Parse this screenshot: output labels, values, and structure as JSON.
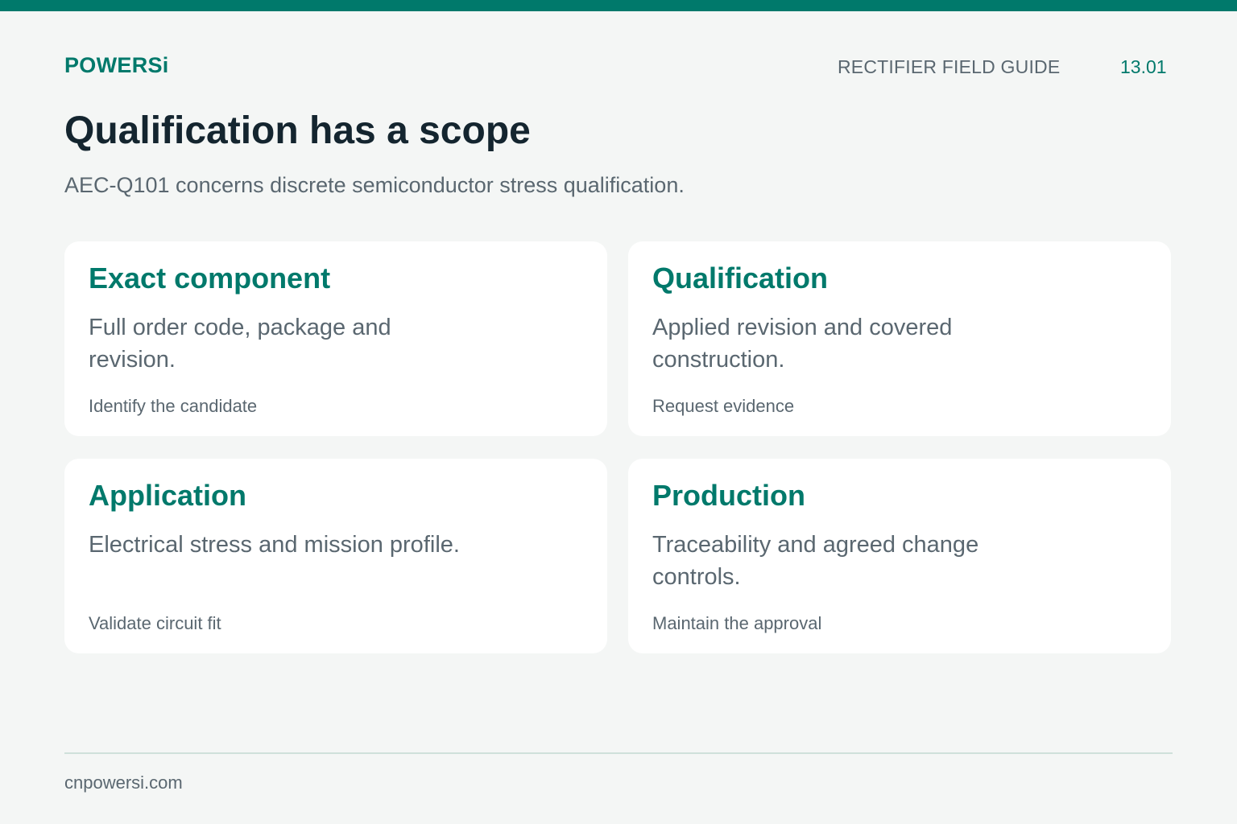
{
  "header": {
    "brand": "POWERSi",
    "guide_name": "RECTIFIER FIELD GUIDE",
    "page_number": "13.01"
  },
  "main": {
    "title": "Qualification has a scope",
    "subtitle": "AEC-Q101 concerns discrete semiconductor stress qualification."
  },
  "cards": [
    {
      "title": "Exact component",
      "body": "Full order code, package and revision.",
      "action": "Identify the candidate"
    },
    {
      "title": "Qualification",
      "body": "Applied revision and covered construction.",
      "action": "Request evidence"
    },
    {
      "title": "Application",
      "body": "Electrical stress and mission profile.",
      "action": "Validate circuit fit"
    },
    {
      "title": "Production",
      "body": "Traceability and agreed change controls.",
      "action": "Maintain the approval"
    }
  ],
  "footer": {
    "site": "cnpowersi.com"
  },
  "colors": {
    "accent": "#00796b",
    "background": "#f4f6f5",
    "title": "#14252f",
    "muted_text": "#5a6770",
    "card": "#ffffff"
  }
}
